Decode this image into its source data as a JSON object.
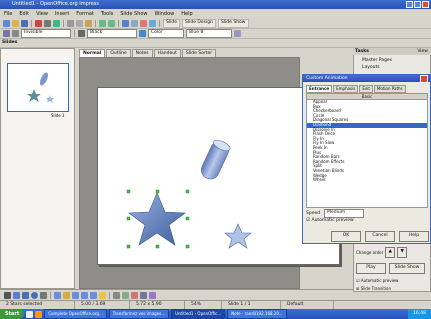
{
  "window": {
    "title": "Untitled1 - OpenOffice.org Impress"
  },
  "menu": [
    "File",
    "Edit",
    "View",
    "Insert",
    "Format",
    "Tools",
    "Slide Show",
    "Window",
    "Help"
  ],
  "toolbar1": {
    "slide_label": "Slide",
    "design_label": "Slide Design",
    "show_label": "Slide Show"
  },
  "toolbar2": {
    "style_value": "Invisible",
    "line_value": "Black",
    "area_mode": "Color",
    "area_value": "Blue 8"
  },
  "slides_pane": {
    "title": "Slides",
    "thumb_caption": "Slide 1"
  },
  "view_tabs": [
    "Normal",
    "Outline",
    "Notes",
    "Handout",
    "Slide Sorter"
  ],
  "tasks_pane": {
    "title": "Tasks",
    "view_label": "View",
    "items": [
      "Master Pages",
      "Layouts"
    ]
  },
  "dialog": {
    "title": "Custom Animation",
    "tabs": [
      "Entrance",
      "Emphasis",
      "Exit",
      "Motion Paths"
    ],
    "list_header": "Basic",
    "effects": [
      "Appear",
      "Box",
      "Checkerboard",
      "Circle",
      "Diagonal Squares",
      "Diamond",
      "Dissolve In",
      "Flash Once",
      "Fly In",
      "Fly In Slow",
      "Peek In",
      "Plus",
      "Random Bars",
      "Random Effects",
      "Split",
      "Venetian Blinds",
      "Wedge",
      "Wheel"
    ],
    "selected": "Diamond",
    "speed_label": "Speed",
    "speed_value": "Medium",
    "auto_preview": "Automatic preview",
    "ok": "OK",
    "cancel": "Cancel",
    "help": "Help"
  },
  "panel_below": {
    "change_order": "Change order",
    "play": "Play",
    "slide_show": "Slide Show",
    "automatic_preview": "Automatic preview",
    "slide_transition": "Slide Transition"
  },
  "status": {
    "selection": "2 Stars selected",
    "position": "5.00 / 3.69",
    "size": "5.72 x 5.90",
    "zoom": "54%",
    "slide": "Slide 1 / 1",
    "layout": "Default"
  },
  "taskbar": {
    "start": "Start",
    "tasks": [
      "Complete OpenOffice.org...",
      "Transformez vos images...",
      "Untitled1 - OpenOffic...",
      "Note - randil192.168.20..."
    ],
    "time": "16:48"
  }
}
